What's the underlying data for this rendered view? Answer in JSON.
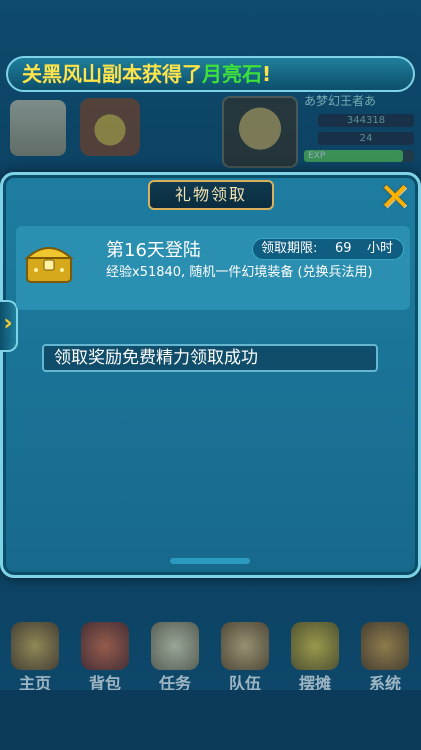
{
  "ticker": {
    "part1": "关黑风山副本获得了",
    "item": "月亮石",
    "part2": "!",
    "color_main": "#ffe34a",
    "color_item": "#3ee03a"
  },
  "hud": {
    "player_name": "あ梦幻王者あ",
    "stat1": "344318",
    "stat2": "24",
    "exp_label": "EXP",
    "exp_fraction": 0.9
  },
  "dialog": {
    "title": "礼物领取",
    "close_icon": "close-x-icon",
    "side_tab_icon": "chevron-right-icon",
    "reward": {
      "icon": "treasure-chest-icon",
      "title": "第16天登陆",
      "deadline_label": "领取期限:",
      "deadline_value": "69",
      "deadline_unit": "小时",
      "description": "经验x51840, 随机一件幻境装备 (兑换兵法用)"
    },
    "result_message": "领取奖励免费精力领取成功"
  },
  "bottom_nav": [
    {
      "label": "主页",
      "icon": "home-building-icon"
    },
    {
      "label": "背包",
      "icon": "backpack-icon"
    },
    {
      "label": "任务",
      "icon": "scroll-icon"
    },
    {
      "label": "队伍",
      "icon": "team-icon"
    },
    {
      "label": "摆摊",
      "icon": "stall-icon"
    },
    {
      "label": "系统",
      "icon": "gear-icon"
    }
  ]
}
